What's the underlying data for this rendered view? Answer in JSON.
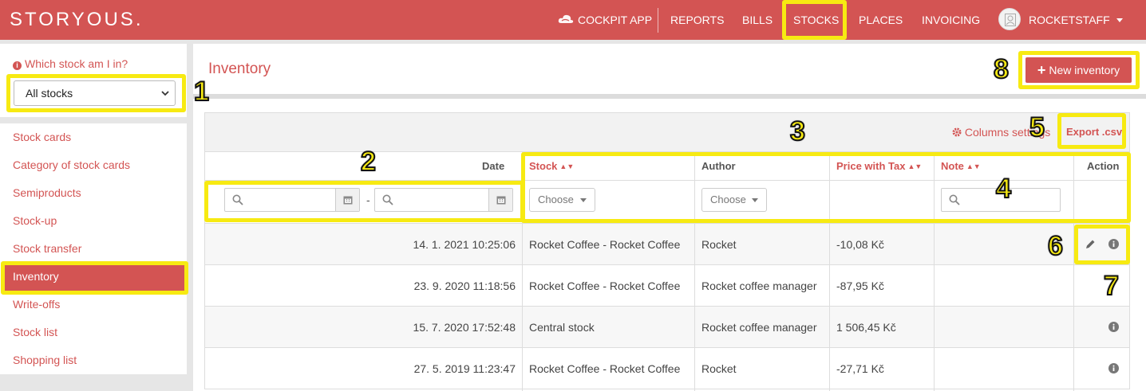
{
  "brand": {
    "logo": "STORYOUS."
  },
  "nav": {
    "cockpit": "COCKPIT APP",
    "reports": "REPORTS",
    "bills": "BILLS",
    "stocks": "STOCKS",
    "places": "PLACES",
    "invoicing": "INVOICING",
    "user": "ROCKETSTAFF"
  },
  "sidebar": {
    "which_label": "Which stock am I in?",
    "stock_select": "All stocks",
    "items": [
      {
        "label": "Stock cards"
      },
      {
        "label": "Category of stock cards"
      },
      {
        "label": "Semiproducts"
      },
      {
        "label": "Stock-up"
      },
      {
        "label": "Stock transfer"
      },
      {
        "label": "Inventory"
      },
      {
        "label": "Write-offs"
      },
      {
        "label": "Stock list"
      },
      {
        "label": "Shopping list"
      }
    ]
  },
  "page": {
    "title": "Inventory",
    "new_button": "New inventory",
    "columns_settings": "Columns settings",
    "export": "Export .csv"
  },
  "table": {
    "columns": {
      "date": "Date",
      "stock": "Stock",
      "author": "Author",
      "price": "Price with Tax",
      "note": "Note",
      "action": "Action"
    },
    "filters": {
      "date_sep": "-",
      "stock_choose": "Choose",
      "author_choose": "Choose"
    },
    "rows": [
      {
        "date": "14. 1. 2021 10:25:06",
        "stock": "Rocket Coffee - Rocket Coffee",
        "author": "Rocket",
        "price": "-10,08 Kč",
        "note": ""
      },
      {
        "date": "23. 9. 2020 11:18:56",
        "stock": "Rocket Coffee - Rocket Coffee",
        "author": "Rocket coffee manager",
        "price": "-87,95 Kč",
        "note": ""
      },
      {
        "date": "15. 7. 2020 17:52:48",
        "stock": "Central stock",
        "author": "Rocket coffee manager",
        "price": "1 506,45 Kč",
        "note": ""
      },
      {
        "date": "27. 5. 2019 11:23:47",
        "stock": "Rocket Coffee - Rocket Coffee",
        "author": "Rocket",
        "price": "-27,71 Kč",
        "note": ""
      }
    ]
  },
  "annotations": [
    "1",
    "2",
    "3",
    "4",
    "5",
    "6",
    "7",
    "8"
  ],
  "colors": {
    "accent": "#d35453",
    "highlight": "#f7ea12"
  }
}
